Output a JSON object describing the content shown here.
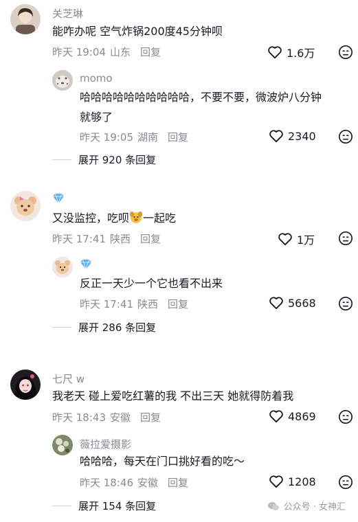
{
  "comments": [
    {
      "name": "关芝琳",
      "text": "能咋办呢 空气炸锅200度45分钟呗",
      "time": "昨天 19:04",
      "region": "山东",
      "reply_label": "回复",
      "likes": "1.6万",
      "avatar_icon": "girl-avatar",
      "reply": {
        "name": "momo",
        "text_line1": "哈哈哈哈哈哈哈哈哈哈，不要不要，微波炉八分钟",
        "text_line2": "就够了",
        "time": "昨天 19:05",
        "region": "湖南",
        "reply_label": "回复",
        "likes": "2340",
        "avatar_icon": "leopard-avatar"
      },
      "expand_label": "展开 920 条回复"
    },
    {
      "name_badge_icon": "diamond-icon",
      "text_before_emoji": "又没监控，吃呗",
      "text_after_emoji": "一起吃",
      "emoji_icon": "dog-face-emoji",
      "time": "昨天 17:41",
      "region": "陕西",
      "reply_label": "回复",
      "likes": "1万",
      "avatar_icon": "bear-avatar",
      "reply": {
        "name_badge_icon": "diamond-icon",
        "text": "反正一天少一个它也看不出来",
        "time": "昨天 17:41",
        "region": "陕西",
        "reply_label": "回复",
        "likes": "5668",
        "avatar_icon": "bear-avatar"
      },
      "expand_label": "展开 286 条回复"
    },
    {
      "name": "七尺 w",
      "text": "我老天 碰上爱吃红薯的我 不出三天 她就得防着我",
      "time": "昨天 18:43",
      "region": "安徽",
      "reply_label": "回复",
      "likes": "4869",
      "avatar_icon": "anime-girl-avatar",
      "reply": {
        "name": "薇拉爱摄影",
        "text": "哈哈哈，每天在门口挑好看的吃～",
        "time": "昨天 18:46",
        "region": "安徽",
        "reply_label": "回复",
        "likes": "1208",
        "avatar_icon": "flower-avatar"
      },
      "expand_label": "展开 154 条回复"
    }
  ],
  "watermark": {
    "text": "公众号 · 女神汇",
    "icon": "wechat-icon"
  },
  "colors": {
    "text": "#161823",
    "meta": "#8a8b91",
    "diamond": "#5ab0ff"
  }
}
